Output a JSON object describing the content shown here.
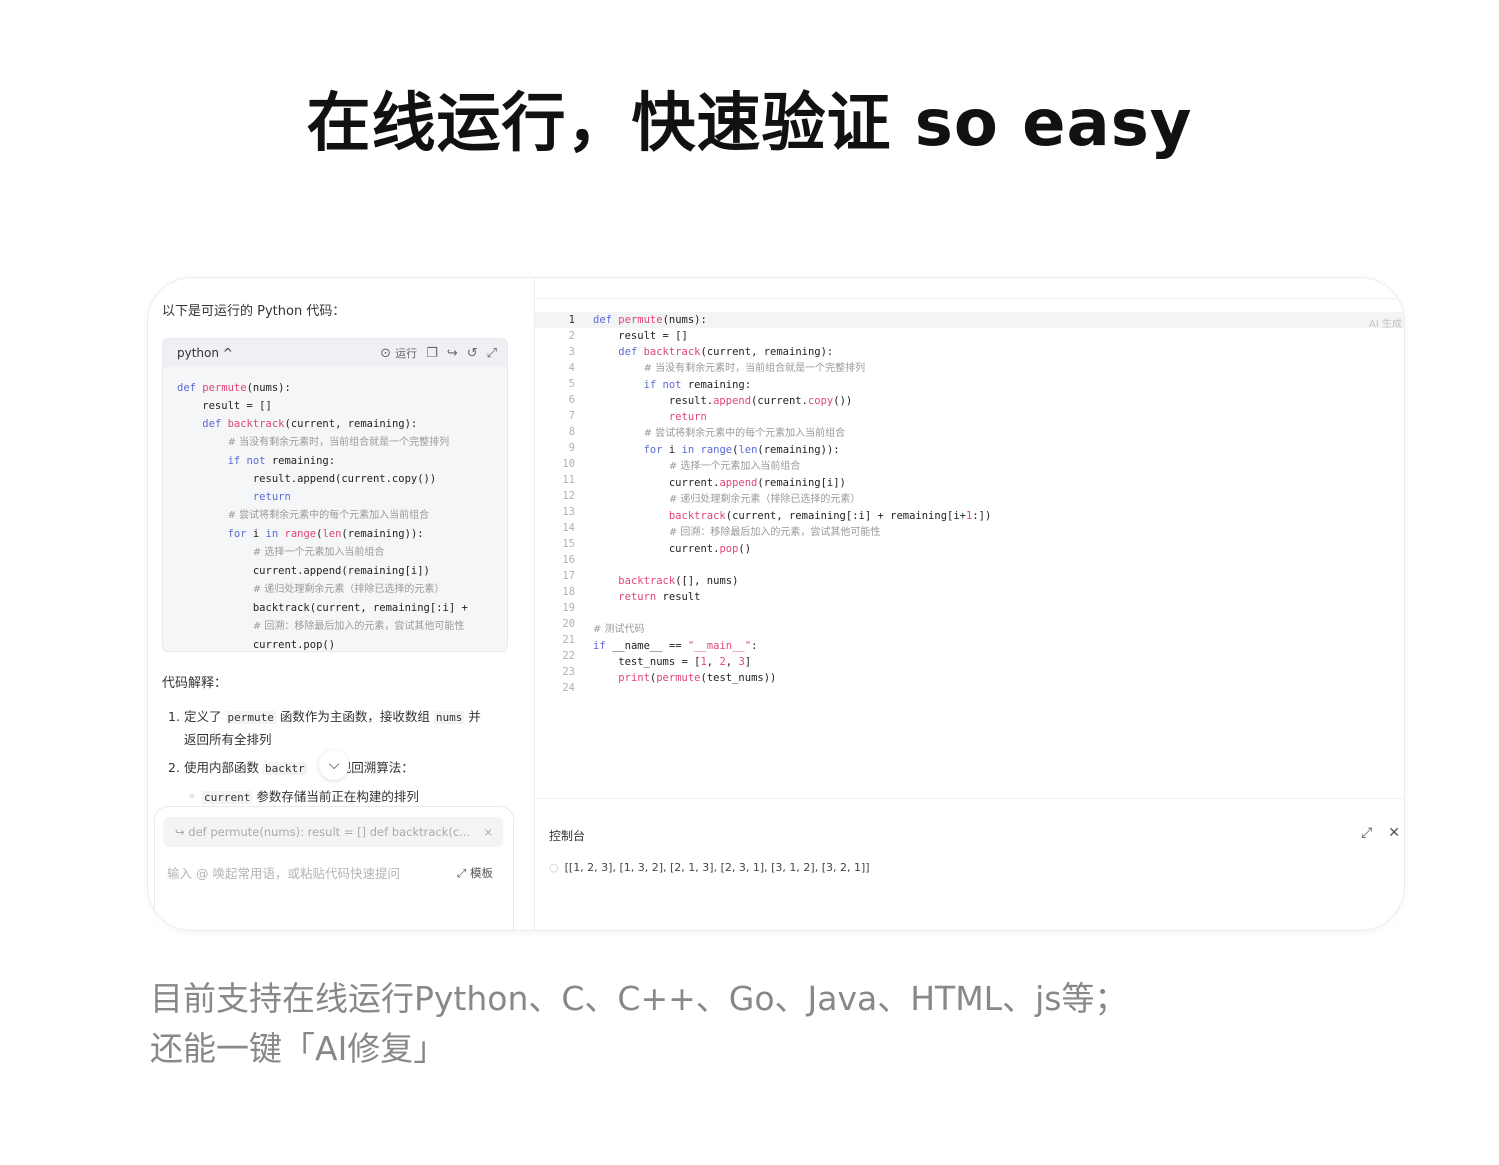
{
  "headline": "在线运行，快速验证 so easy",
  "chat": {
    "intro": "以下是可运行的 Python 代码：",
    "code_lang": "python ^",
    "run_label": "运行",
    "explain_title": "代码解释：",
    "item1_a": "定义了",
    "item1_code": "permute",
    "item1_b": "函数作为主函数，接收数组",
    "item1_code2": "nums",
    "item1_c": "并",
    "item1_d": "返回所有全排列",
    "item2_a": "使用内部函数",
    "item2_code": "backtr",
    "item2_b": "现回溯算法：",
    "sub1_code": "current",
    "sub1_text": "参数存储当前正在构建的排列",
    "quote_text": "def permute(nums): result = [] def backtrack(c...",
    "input_placeholder": "输入 @ 唤起常用语，或粘贴代码快速提问",
    "template_label": "模板"
  },
  "editor": {
    "ai_badge": "AI 生成",
    "console_title": "控制台",
    "console_output": "[[1, 2, 3], [1, 3, 2], [2, 1, 3], [2, 3, 1], [3, 1, 2], [3, 2, 1]]"
  },
  "caption_line1": "目前支持在线运行Python、C、C++、Go、Java、HTML、js等；",
  "caption_line2": "还能一键「AI修复」",
  "icons": {
    "run": "play-circle-icon",
    "copy": "copy-icon",
    "share": "share-icon",
    "history": "history-icon",
    "fullscreen": "fullscreen-icon",
    "collapse": "chevron-down-icon",
    "quote": "reply-icon",
    "close": "close-icon"
  },
  "colors": {
    "keyword": "#5b6bd6",
    "function": "#e0457b",
    "comment": "#9a9a9a",
    "caption": "#888888"
  }
}
